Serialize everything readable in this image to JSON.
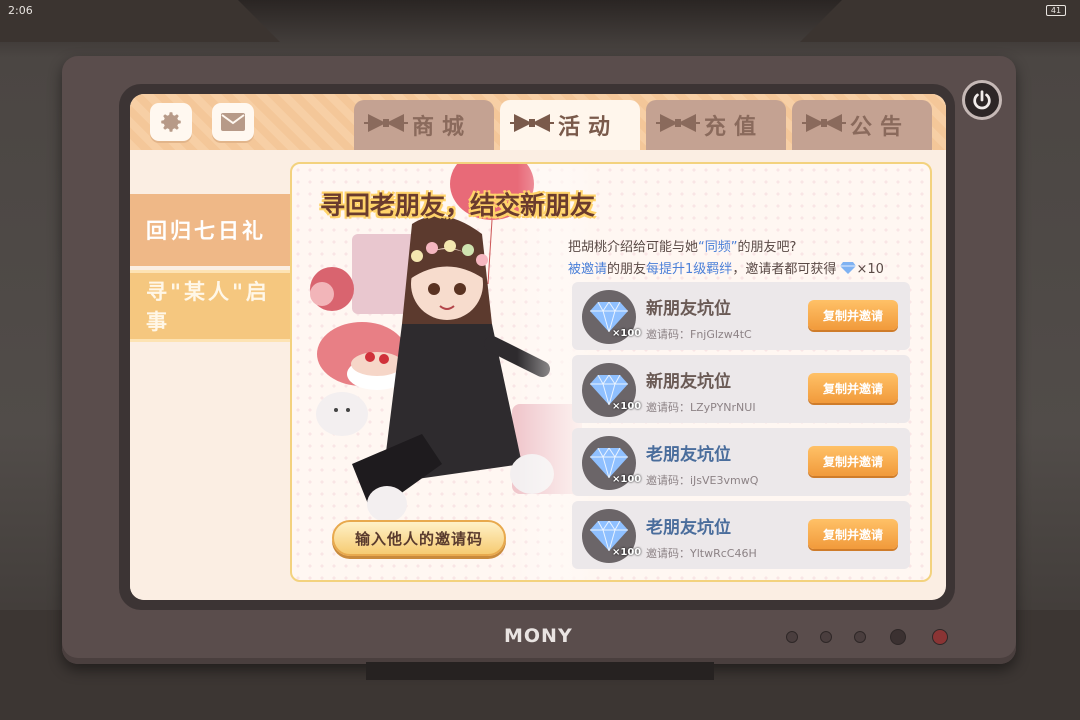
{
  "status_bar": {
    "time": "2:06",
    "battery": "41"
  },
  "monitor": {
    "brand": "MONY"
  },
  "tabs": [
    {
      "label": "商城",
      "active": false
    },
    {
      "label": "活动",
      "active": true
    },
    {
      "label": "充值",
      "active": false
    },
    {
      "label": "公告",
      "active": false
    }
  ],
  "sidebar": {
    "items": [
      {
        "label": "回归七日礼",
        "active": false
      },
      {
        "label": "寻\"某人\"启事",
        "active": true
      }
    ]
  },
  "panel": {
    "headline": "寻回老朋友，结交新朋友",
    "desc_line1": {
      "prefix": "把胡桃介绍给可能与她",
      "highlight": "“同频”",
      "suffix": "的朋友吧?"
    },
    "desc_line2": {
      "h1": "被邀请",
      "t1": "的朋友",
      "h2": "每提升1级羁绊",
      "t2": "，邀请者都可获得",
      "reward": "×10"
    },
    "input_button": "输入他人的邀请码",
    "slots": [
      {
        "title": "新朋友坑位",
        "type": "new",
        "qty": "×100",
        "code": "邀请码：FnjGlzw4tC",
        "button": "复制并邀请"
      },
      {
        "title": "新朋友坑位",
        "type": "new",
        "qty": "×100",
        "code": "邀请码：LZyPYNrNUI",
        "button": "复制并邀请"
      },
      {
        "title": "老朋友坑位",
        "type": "old",
        "qty": "×100",
        "code": "邀请码：iJsVE3vmwQ",
        "button": "复制并邀请"
      },
      {
        "title": "老朋友坑位",
        "type": "old",
        "qty": "×100",
        "code": "邀请码：YltwRcC46H",
        "button": "复制并邀请"
      }
    ]
  },
  "icons": {
    "settings": "gear-icon",
    "mail": "mail-icon",
    "power": "power-icon",
    "gem": "diamond-icon"
  },
  "colors": {
    "accent_orange": "#f19a3b",
    "highlight_blue": "#4a7fd8",
    "tab_active": "#fff6ec",
    "tab_inactive": "#c4a292"
  }
}
